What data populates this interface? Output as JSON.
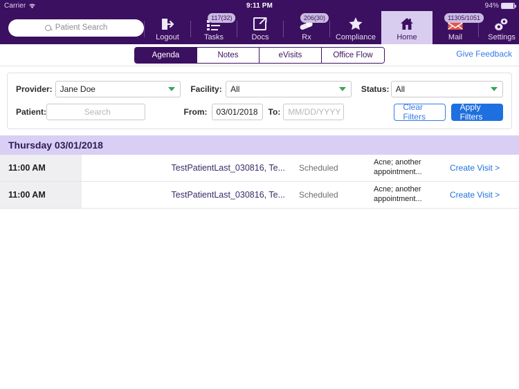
{
  "status_bar": {
    "carrier": "Carrier",
    "wifi_icon": "wifi-icon",
    "time": "9:11 PM",
    "battery_percent": "94%"
  },
  "nav": {
    "search_placeholder": "Patient Search",
    "search_value": "",
    "items": [
      {
        "label": "Logout",
        "icon": "logout-icon",
        "badge": null,
        "active": false
      },
      {
        "label": "Tasks",
        "icon": "tasks-icon",
        "badge": "117(32)",
        "active": false
      },
      {
        "label": "Docs",
        "icon": "docs-icon",
        "badge": null,
        "active": false
      },
      {
        "label": "Rx",
        "icon": "rx-pill-icon",
        "badge": "206(30)",
        "active": false
      },
      {
        "label": "Compliance",
        "icon": "star-icon",
        "badge": null,
        "active": false
      },
      {
        "label": "Home",
        "icon": "home-icon",
        "badge": null,
        "active": true
      },
      {
        "label": "Mail",
        "icon": "mail-envelope-icon",
        "badge": "11305/1051",
        "active": false
      },
      {
        "label": "Settings",
        "icon": "gears-icon",
        "badge": null,
        "active": false
      }
    ]
  },
  "tabs": {
    "items": [
      {
        "label": "Agenda",
        "active": true
      },
      {
        "label": "Notes",
        "active": false
      },
      {
        "label": "eVisits",
        "active": false
      },
      {
        "label": "Office Flow",
        "active": false
      }
    ],
    "feedback_link": "Give Feedback"
  },
  "filters": {
    "provider_label": "Provider:",
    "provider_value": "Jane Doe",
    "facility_label": "Facility:",
    "facility_value": "All",
    "status_label": "Status:",
    "status_value": "All",
    "patient_label": "Patient:",
    "patient_placeholder": "Search",
    "patient_value": "",
    "from_label": "From:",
    "from_value": "03/01/2018",
    "to_label": "To:",
    "to_placeholder": "MM/DD/YYYY",
    "to_value": "",
    "clear_button": "Clear Filters",
    "apply_button": "Apply Filters"
  },
  "agenda": {
    "date_header": "Thursday 03/01/2018",
    "rows": [
      {
        "time": "11:00 AM",
        "patient": "TestPatientLast_030816, Te...",
        "status": "Scheduled",
        "reason": "Acne; another appointment...",
        "action": "Create Visit >"
      },
      {
        "time": "11:00 AM",
        "patient": "TestPatientLast_030816, Te...",
        "status": "Scheduled",
        "reason": "Acne; another appointment...",
        "action": "Create Visit >"
      }
    ]
  },
  "colors": {
    "brand_purple": "#3B1060",
    "active_tab_lavender": "#D8CDEE",
    "date_header_lavender": "#D9CFF5",
    "link_blue": "#3579E8",
    "primary_button_blue": "#1E70E0",
    "dropdown_caret_green": "#34A853",
    "badge_lavender": "#C9BBE0"
  }
}
